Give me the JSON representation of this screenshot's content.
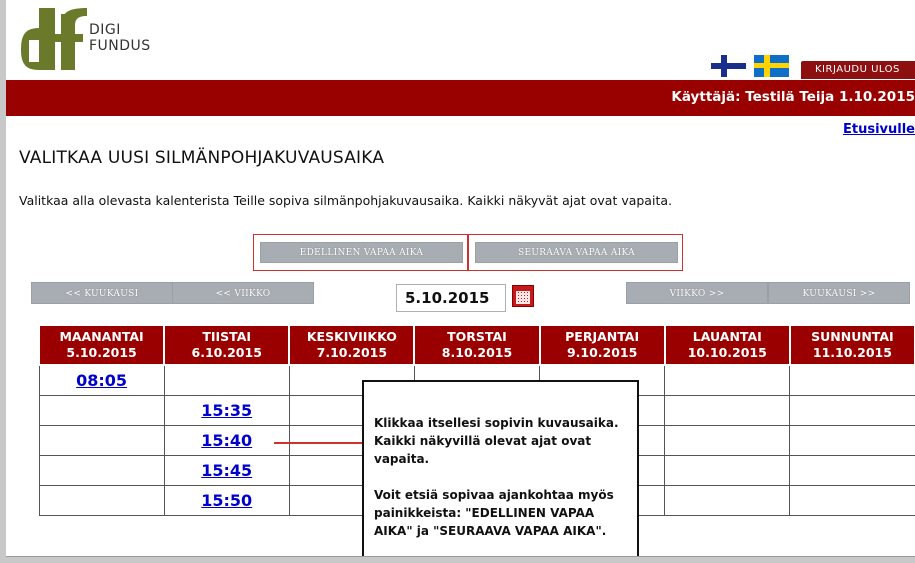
{
  "logo": {
    "line1": "DIGI",
    "line2": "FUNDUS",
    "green": "#6b7a2a"
  },
  "header": {
    "logout_label": "KIRJAUDU ULOS",
    "user_info": "Käyttäjä: Testilä Teija 1.10.2015",
    "home_link": "Etusivulle",
    "accent_color": "#990000"
  },
  "page": {
    "title": "VALITKAA UUSI SILMÄNPOHJAKUVAUSAIKA",
    "description": "Valitkaa alla olevasta kalenterista Teille sopiva silmänpohjakuvausaika. Kaikki näkyvät ajat ovat vapaita."
  },
  "free_buttons": {
    "previous": "EDELLINEN VAPAA AIKA",
    "next": "SEURAAVA VAPAA AIKA"
  },
  "nav": {
    "month_prev": "<< KUUKAUSI",
    "week_prev": "<< VIIKKO",
    "week_next": "VIIKKO >>",
    "month_next": "KUUKAUSI >>",
    "date_value": "5.10.2015"
  },
  "calendar": {
    "days": [
      {
        "name": "MAANANTAI",
        "date": "5.10.2015"
      },
      {
        "name": "TIISTAI",
        "date": "6.10.2015"
      },
      {
        "name": "KESKIVIIKKO",
        "date": "7.10.2015"
      },
      {
        "name": "TORSTAI",
        "date": "8.10.2015"
      },
      {
        "name": "PERJANTAI",
        "date": "9.10.2015"
      },
      {
        "name": "LAUANTAI",
        "date": "10.10.2015"
      },
      {
        "name": "SUNNUNTAI",
        "date": "11.10.2015"
      }
    ],
    "rows": [
      [
        "08:05",
        "",
        "",
        "",
        "",
        "",
        ""
      ],
      [
        "",
        "15:35",
        "",
        "",
        "",
        "",
        ""
      ],
      [
        "",
        "15:40",
        "",
        "",
        "",
        "",
        ""
      ],
      [
        "",
        "15:45",
        "",
        "",
        "",
        "",
        ""
      ],
      [
        "",
        "15:50",
        "",
        "",
        "",
        "",
        ""
      ]
    ]
  },
  "tooltip": {
    "line1": "Klikkaa itsellesi sopivin kuvausaika. Kaikki näkyvillä olevat ajat ovat vapaita.",
    "line2": "Voit etsiä sopivaa ajankohtaa myös painikkeista: \"EDELLINEN VAPAA AIKA\" ja \"SEURAAVA VAPAA AIKA\"."
  }
}
